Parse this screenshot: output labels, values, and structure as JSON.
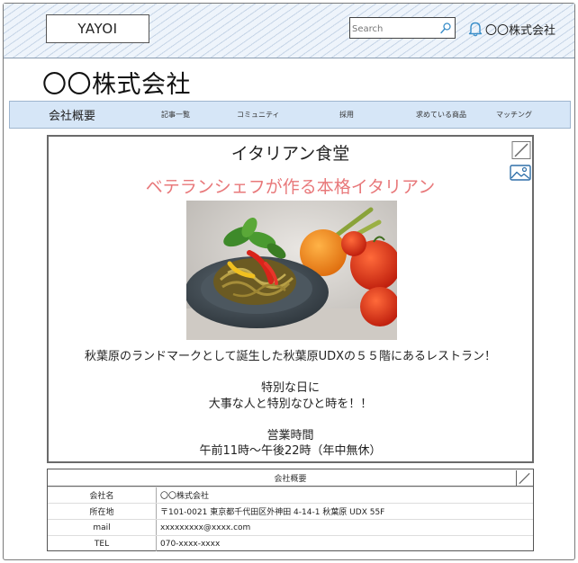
{
  "header": {
    "logo_text": "YAYOI",
    "search_placeholder": "Search",
    "user_name": "〇〇株式会社",
    "icons": [
      "search-icon",
      "bell-icon"
    ]
  },
  "company": {
    "title": "〇〇株式会社"
  },
  "nav": {
    "items": [
      {
        "label": "会社概要"
      },
      {
        "label": "記事一覧"
      },
      {
        "label": "コミュニティ"
      },
      {
        "label": "採用"
      },
      {
        "label": "求めている商品"
      },
      {
        "label": "マッチング"
      }
    ]
  },
  "card": {
    "title": "イタリアン食堂",
    "subtitle": "ベテランシェフが作る本格イタリアン",
    "lines": [
      "秋葉原のランドマークとして誕生した秋葉原UDXの５５階にあるレストラン！",
      "",
      "特別な日に",
      "大事な人と特別なひと時を！！",
      "",
      "営業時間",
      "午前11時〜午後22時（年中無休）"
    ],
    "icons": [
      "edit-icon",
      "image-icon"
    ]
  },
  "info": {
    "title": "会社概要",
    "rows": [
      {
        "key": "会社名",
        "value": "〇〇株式会社"
      },
      {
        "key": "所在地",
        "value": "〒101-0021 東京都千代田区外神田 4-14-1 秋葉原 UDX 55F"
      },
      {
        "key": "mail",
        "value": "xxxxxxxxx@xxxx.com"
      },
      {
        "key": "TEL",
        "value": "070-xxxx-xxxx"
      }
    ]
  },
  "colors": {
    "header_bg": "#eef4fb",
    "nav_bg": "#d6e6f7",
    "subtitle": "#e8787a"
  }
}
